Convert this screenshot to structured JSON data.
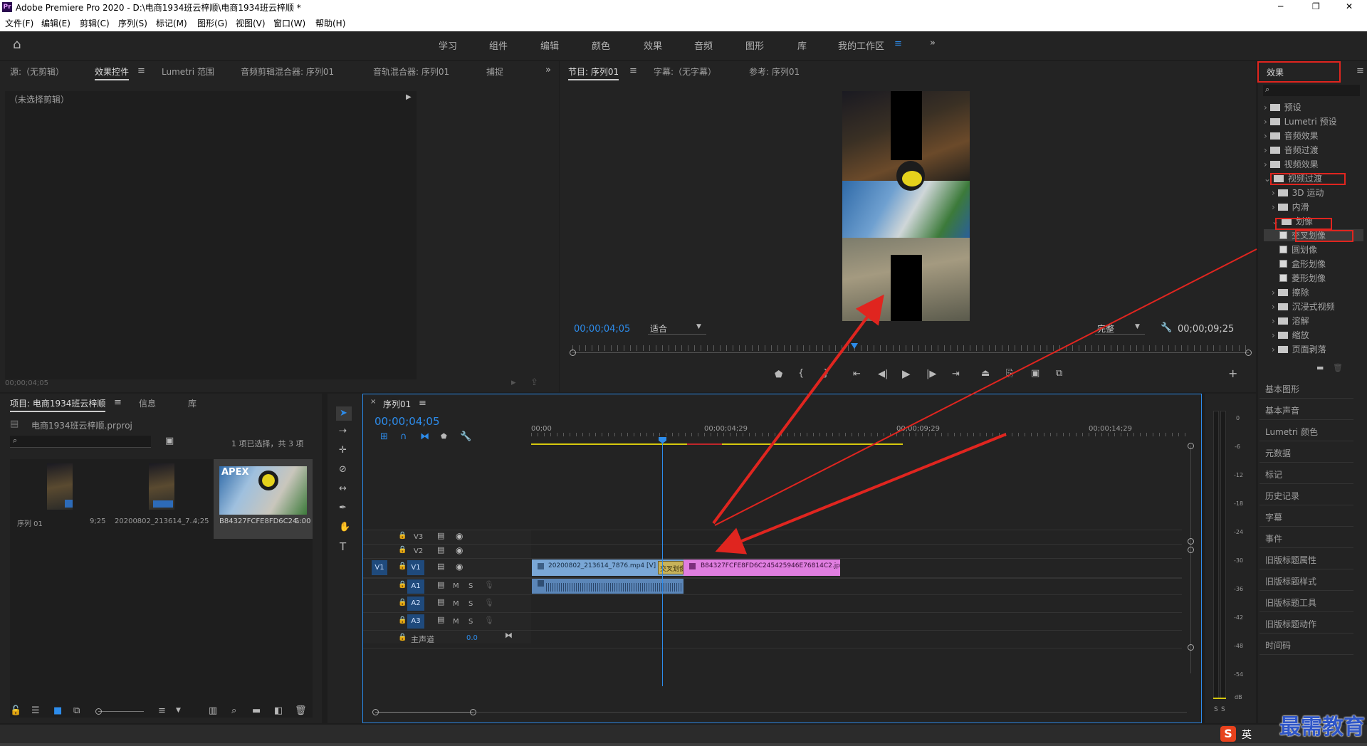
{
  "titlebar": {
    "app_title": "Adobe Premiere Pro 2020 - D:\\电商1934班云梓顺\\电商1934班云梓顺 *",
    "pr_logo": "Pr",
    "min": "─",
    "max": "❐",
    "close": "✕"
  },
  "menu": [
    "文件(F)",
    "编辑(E)",
    "剪辑(C)",
    "序列(S)",
    "标记(M)",
    "图形(G)",
    "视图(V)",
    "窗口(W)",
    "帮助(H)"
  ],
  "workspaces": [
    "学习",
    "组件",
    "编辑",
    "颜色",
    "效果",
    "音频",
    "图形",
    "库",
    "我的工作区"
  ],
  "source_panel": {
    "tabs": [
      "源:（无剪辑）",
      "效果控件",
      "Lumetri 范围",
      "音频剪辑混合器: 序列01",
      "音轨混合器: 序列01",
      "捕捉"
    ],
    "no_clip": "（未选择剪辑）",
    "timecode": "00;00;04;05"
  },
  "program_panel": {
    "tabs": [
      "节目: 序列01",
      "字幕:（无字幕）",
      "参考: 序列01"
    ],
    "timecode": "00;00;04;05",
    "fit": "适合",
    "quality": "完整",
    "duration": "00;00;09;25",
    "playhead_fraction": 0.417
  },
  "project_panel": {
    "tabs": [
      "项目: 电商1934班云梓顺",
      "信息",
      "库"
    ],
    "file": "电商1934班云梓顺.prproj",
    "selection_info": "1 项已选择，共 3 项",
    "items": [
      {
        "name": "序列 01",
        "duration": "9;25"
      },
      {
        "name": "20200802_213614_7...",
        "duration": "4;25"
      },
      {
        "name": "B84327FCFE8FD6C24...",
        "duration": "5:00"
      }
    ],
    "thumb_text": "APEX"
  },
  "timeline": {
    "tab": "序列01",
    "timecode": "00;00;04;05",
    "ruler": [
      "00;00",
      "00;00;04;29",
      "00;00;09;29",
      "00;00;14;29"
    ],
    "tracks_video": [
      "V3",
      "V2",
      "V1"
    ],
    "tracks_audio": [
      "A1",
      "A2",
      "A3"
    ],
    "v1_source": "V1",
    "master_label": "主声道",
    "master_value": "0.0",
    "mute": "M",
    "solo": "S",
    "clip_video": "20200802_213614_7876.mp4 [V]",
    "clip_transition": "交叉划像",
    "clip_image": "B84327FCFE8FD6C245425946E76814C2.jpg"
  },
  "meter": {
    "scale": [
      "0",
      "-6",
      "-12",
      "-18",
      "-24",
      "-30",
      "-36",
      "-42",
      "-48",
      "-54",
      "dB"
    ],
    "bottom": [
      "S",
      "S"
    ]
  },
  "effects_panel": {
    "title": "效果",
    "tree": [
      {
        "label": "预设",
        "level": 0,
        "type": "folder",
        "open": false
      },
      {
        "label": "Lumetri 预设",
        "level": 0,
        "type": "folder",
        "open": false
      },
      {
        "label": "音频效果",
        "level": 0,
        "type": "folder",
        "open": false
      },
      {
        "label": "音频过渡",
        "level": 0,
        "type": "folder",
        "open": false
      },
      {
        "label": "视频效果",
        "level": 0,
        "type": "folder",
        "open": false
      },
      {
        "label": "视频过渡",
        "level": 0,
        "type": "folder",
        "open": true
      },
      {
        "label": "3D 运动",
        "level": 1,
        "type": "folder",
        "open": false
      },
      {
        "label": "内滑",
        "level": 1,
        "type": "folder",
        "open": false
      },
      {
        "label": "划像",
        "level": 1,
        "type": "folder",
        "open": true
      },
      {
        "label": "交叉划像",
        "level": 2,
        "type": "effect"
      },
      {
        "label": "圆划像",
        "level": 2,
        "type": "effect"
      },
      {
        "label": "盒形划像",
        "level": 2,
        "type": "effect"
      },
      {
        "label": "菱形划像",
        "level": 2,
        "type": "effect"
      },
      {
        "label": "擦除",
        "level": 1,
        "type": "folder",
        "open": false
      },
      {
        "label": "沉浸式视频",
        "level": 1,
        "type": "folder",
        "open": false
      },
      {
        "label": "溶解",
        "level": 1,
        "type": "folder",
        "open": false
      },
      {
        "label": "缩放",
        "level": 1,
        "type": "folder",
        "open": false
      },
      {
        "label": "页面剥落",
        "level": 1,
        "type": "folder",
        "open": false
      }
    ]
  },
  "side_panels": [
    "基本图形",
    "基本声音",
    "Lumetri 颜色",
    "元数据",
    "标记",
    "历史记录",
    "字幕",
    "事件",
    "旧版标题属性",
    "旧版标题样式",
    "旧版标题工具",
    "旧版标题动作",
    "时间码"
  ],
  "taskbar": {
    "ime": "英",
    "ime_logo": "S",
    "watermark": "最需教育"
  },
  "colors": {
    "accent": "#2d8ceb",
    "annotation": "#e0251f",
    "clip_video": "#7aa7d6",
    "clip_image": "#e07ee0",
    "clip_audio": "#5b86b8"
  }
}
